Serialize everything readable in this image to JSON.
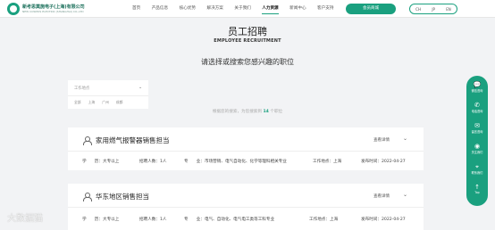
{
  "header": {
    "company_name": "新考思莫施电子(上海)有限公司",
    "company_name_en": "NEW COSMOS ELECTRIC (SHANGHAI) CO.,LTD",
    "nav": [
      "首页",
      "产品信息",
      "核心优势",
      "解决方案",
      "关于我们",
      "人力资源",
      "新闻中心",
      "客户支持"
    ],
    "active_nav": "人力资源",
    "mall_button": "会员商城",
    "languages": [
      "CH",
      "JP",
      "EN"
    ]
  },
  "page": {
    "title_cn": "员工招聘",
    "title_en": "EMPLOYEE RECRUITMENT",
    "prompt": "请选择或搜索您感兴趣的职位"
  },
  "filter": {
    "label": "工作地点",
    "options": [
      "全部",
      "上海",
      "广州",
      "成都"
    ]
  },
  "result": {
    "prefix": "根据您的搜索，为您搜索到",
    "count": "14",
    "suffix": "个职位"
  },
  "jobs": [
    {
      "title": "家用燃气报警器销售担当",
      "detail_label": "查看详情",
      "education": "学　　历：大专以上",
      "headcount": "招聘人数：1人",
      "major": "专　　业：市场营销、电气自动化、化学等理科相关专业",
      "location": "工作地点：上海",
      "date": "发布时间：2022-04-27"
    },
    {
      "title": "华东地区销售担当",
      "detail_label": "查看详情",
      "education": "学　　历：大专以上",
      "headcount": "招聘人数：1人",
      "major": "专　　业：电气、自动化、电气电工类等工科专业",
      "location": "工作地点：上海",
      "date": "发布时间：2022-04-27"
    }
  ],
  "sidebar": [
    {
      "icon": "chat-icon",
      "label": "微信咨询"
    },
    {
      "icon": "phone-icon",
      "label": "电话咨询"
    },
    {
      "icon": "message-icon",
      "label": "留言咨询"
    },
    {
      "icon": "follow-icon",
      "label": "关注我们"
    },
    {
      "icon": "location-icon",
      "label": "联系我们"
    },
    {
      "icon": "top-icon",
      "label": "Top"
    }
  ],
  "watermark": "大数据猫",
  "colors": {
    "accent": "#1aa07f"
  }
}
